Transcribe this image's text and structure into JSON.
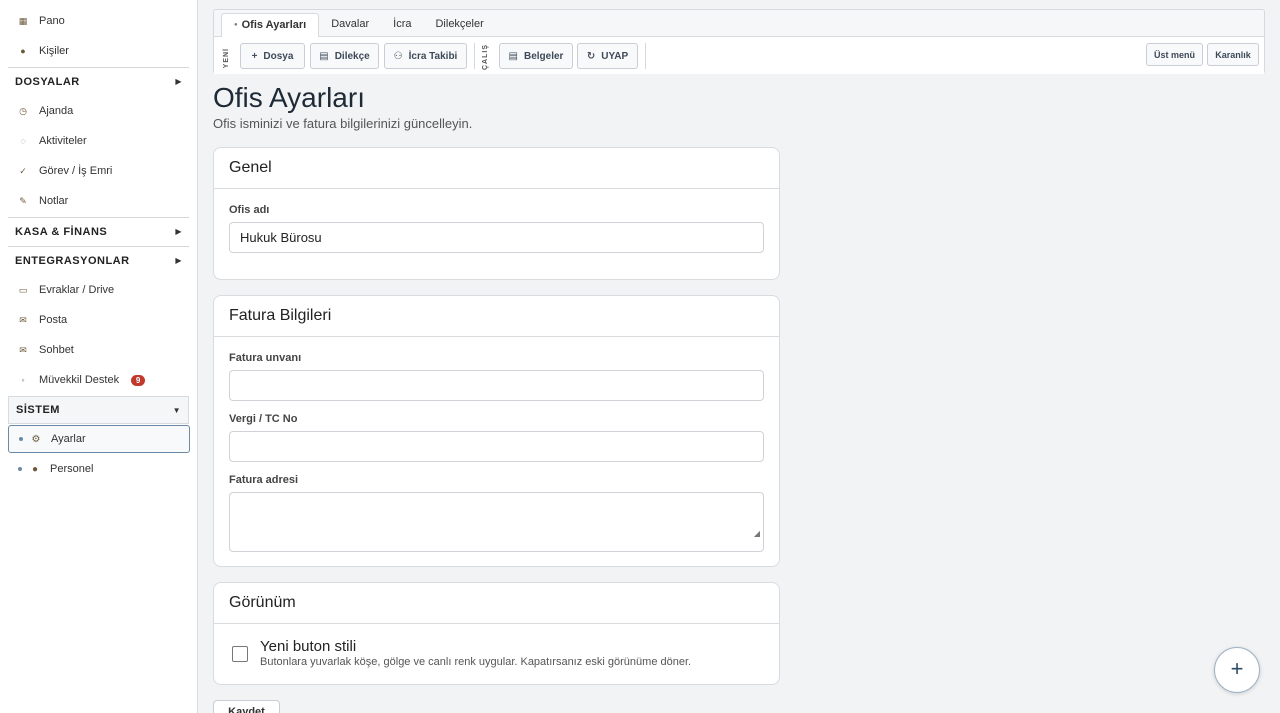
{
  "sidebar": {
    "top_items": [
      {
        "label": "Pano",
        "icon": "dashboard-icon"
      },
      {
        "label": "Kişiler",
        "icon": "contacts-icon"
      }
    ],
    "dosyalar": {
      "label": "DOSYALAR"
    },
    "mid_items": [
      {
        "label": "Ajanda",
        "icon": "calendar-icon"
      },
      {
        "label": "Aktiviteler",
        "icon": "activity-icon"
      },
      {
        "label": "Görev / İş Emri",
        "icon": "check-icon"
      },
      {
        "label": "Notlar",
        "icon": "note-icon"
      }
    ],
    "kasa": {
      "label": "KASA & FİNANS"
    },
    "entegrasyonlar": {
      "label": "ENTEGRASYONLAR"
    },
    "int_items": [
      {
        "label": "Evraklar / Drive",
        "icon": "folder-icon"
      },
      {
        "label": "Posta",
        "icon": "mail-icon"
      },
      {
        "label": "Sohbet",
        "icon": "chat-icon"
      },
      {
        "label": "Müvekkil Destek",
        "icon": "support-icon",
        "badge": "9"
      }
    ],
    "sistem": {
      "label": "SİSTEM"
    },
    "sistem_items": [
      {
        "label": "Ayarlar",
        "icon": "settings-icon"
      },
      {
        "label": "Personel",
        "icon": "staff-icon"
      }
    ]
  },
  "topbar": {
    "tabs": [
      "Ofis Ayarları",
      "Davalar",
      "İcra",
      "Dilekçeler"
    ],
    "yeni_label": "YENİ",
    "calis_label": "ÇALIŞ",
    "buttons": {
      "dosya": "Dosya",
      "dilekce": "Dilekçe",
      "icra_takibi": "İcra Takibi",
      "belgeler": "Belgeler",
      "uyap": "UYAP"
    },
    "ust_menu": "Üst menü",
    "karanlik": "Karanlık"
  },
  "page": {
    "title": "Ofis Ayarları",
    "subtitle": "Ofis isminizi ve fatura bilgilerinizi güncelleyin."
  },
  "genel": {
    "title": "Genel",
    "ofis_adi_label": "Ofis adı",
    "ofis_adi_value": "Hukuk Bürosu"
  },
  "fatura": {
    "title": "Fatura Bilgileri",
    "unvan_label": "Fatura unvanı",
    "unvan_value": "",
    "vergi_label": "Vergi / TC No",
    "vergi_value": "",
    "adres_label": "Fatura adresi",
    "adres_value": ""
  },
  "gorunum": {
    "title": "Görünüm",
    "option_title": "Yeni buton stili",
    "option_desc": "Butonlara yuvarlak köşe, gölge ve canlı renk uygular. Kapatırsanız eski görünüme döner.",
    "checked": false
  },
  "save_label": "Kaydet",
  "fab_symbol": "+"
}
